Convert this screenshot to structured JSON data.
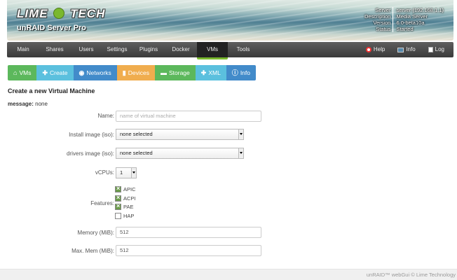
{
  "header": {
    "logo_left": "LIME",
    "logo_right": "TECH",
    "subtitle": "unRAID Server Pro",
    "server_info": [
      {
        "key": "Server",
        "value": "server (192.168.1.1)"
      },
      {
        "key": "Description",
        "value": "Media Server"
      },
      {
        "key": "Version",
        "value": "6.0-beta10a"
      },
      {
        "key": "Status",
        "value": "Started"
      }
    ]
  },
  "nav": {
    "items": [
      "Main",
      "Shares",
      "Users",
      "Settings",
      "Plugins",
      "Docker",
      "VMs",
      "Tools"
    ],
    "active": "VMs",
    "right": [
      "Help",
      "Info",
      "Log"
    ]
  },
  "tabs": [
    {
      "label": "VMs",
      "icon": "home-icon"
    },
    {
      "label": "Create",
      "icon": "plus-icon"
    },
    {
      "label": "Networks",
      "icon": "globe-icon"
    },
    {
      "label": "Devices",
      "icon": "bar-chart-icon"
    },
    {
      "label": "Storage",
      "icon": "hdd-icon"
    },
    {
      "label": "XML",
      "icon": "plus-icon"
    },
    {
      "label": "Info",
      "icon": "info-icon"
    }
  ],
  "form": {
    "title": "Create a new Virtual Machine",
    "message_label": "message:",
    "message_value": "none",
    "name_label": "Name:",
    "name_placeholder": "name of virtual machine",
    "install_label": "Install image (iso):",
    "install_value": "none selected",
    "drivers_label": "drivers image (iso):",
    "drivers_value": "none selected",
    "vcpus_label": "vCPUs:",
    "vcpus_value": "1",
    "features_label": "Features:",
    "features": [
      {
        "label": "APIC",
        "checked": true
      },
      {
        "label": "ACPI",
        "checked": true
      },
      {
        "label": "PAE",
        "checked": true
      },
      {
        "label": "HAP",
        "checked": false
      }
    ],
    "memory_label": "Memory (MiB):",
    "memory_value": "512",
    "maxmem_label": "Max. Mem (MiB):",
    "maxmem_value": "512"
  },
  "footer": "unRAID™ webGui © Lime Technology"
}
